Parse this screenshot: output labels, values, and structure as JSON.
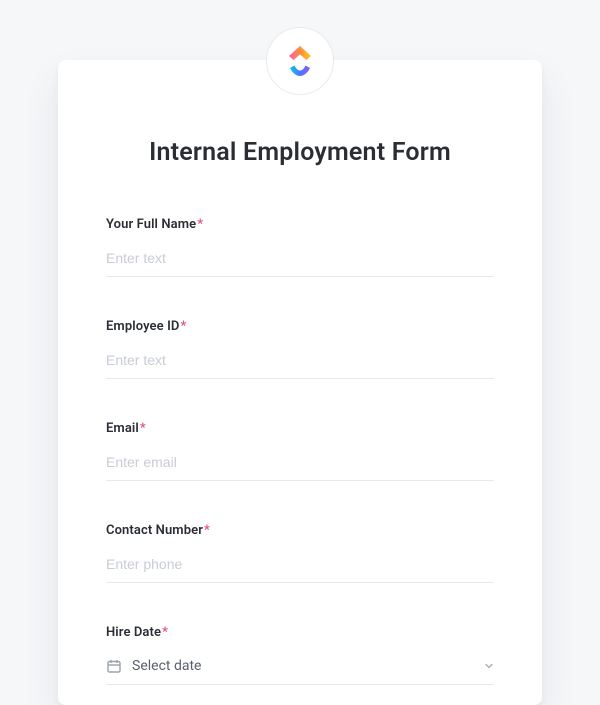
{
  "form": {
    "title": "Internal Employment Form",
    "required_mark": "*"
  },
  "fields": {
    "full_name": {
      "label": "Your Full Name",
      "placeholder": "Enter text",
      "value": ""
    },
    "employee_id": {
      "label": "Employee ID",
      "placeholder": "Enter text",
      "value": ""
    },
    "email": {
      "label": "Email",
      "placeholder": "Enter email",
      "value": ""
    },
    "contact_number": {
      "label": "Contact Number",
      "placeholder": "Enter phone",
      "value": ""
    },
    "hire_date": {
      "label": "Hire Date",
      "placeholder": "Select date",
      "value": ""
    }
  },
  "icons": {
    "calendar": "calendar-icon",
    "chevron_down": "chevron-down-icon",
    "logo": "clickup-logo"
  }
}
